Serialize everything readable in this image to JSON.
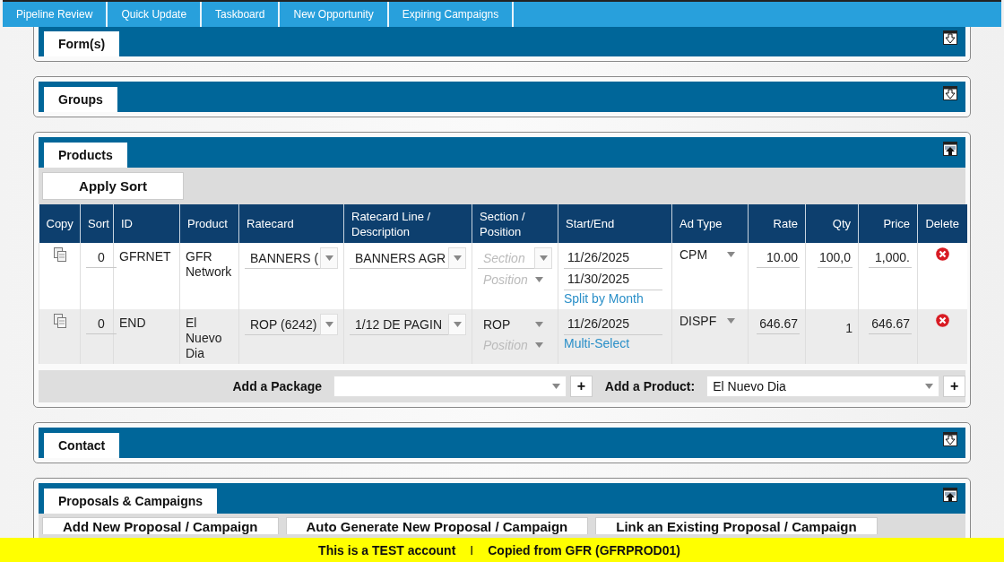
{
  "nav_tabs": [
    {
      "label": "Pipeline Review"
    },
    {
      "label": "Quick Update"
    },
    {
      "label": "Taskboard"
    },
    {
      "label": "New Opportunity"
    },
    {
      "label": "Expiring Campaigns"
    }
  ],
  "sections": [
    {
      "title": "Form(s)",
      "expanded": false,
      "kind": "plain"
    },
    {
      "title": "Groups",
      "expanded": false,
      "kind": "plain"
    },
    {
      "title": "Products",
      "expanded": true,
      "kind": "products"
    },
    {
      "title": "Contact",
      "expanded": false,
      "kind": "plain"
    },
    {
      "title": "Proposals & Campaigns",
      "expanded": true,
      "kind": "proposals"
    }
  ],
  "products": {
    "apply_sort_button": "Apply Sort",
    "columns": [
      {
        "label": "Copy"
      },
      {
        "label": "Sort"
      },
      {
        "label": "ID"
      },
      {
        "label": "Product"
      },
      {
        "label": "Ratecard"
      },
      {
        "label": "Ratecard Line / Description"
      },
      {
        "label": "Section / Position"
      },
      {
        "label": "Start/End"
      },
      {
        "label": "Ad Type"
      },
      {
        "label": "Rate"
      },
      {
        "label": "Qty"
      },
      {
        "label": "Price"
      },
      {
        "label": "Delete"
      }
    ],
    "rows": [
      {
        "sort": "0",
        "id": "GFRNET",
        "product": "GFR Network",
        "ratecard": "BANNERS (",
        "line": "BANNERS AGR",
        "section": {
          "placeholder": "Section"
        },
        "position": {
          "placeholder": "Position"
        },
        "dates": [
          "11/26/2025",
          "11/30/2025"
        ],
        "link": "Split by Month",
        "ad_type": "CPM",
        "rate": "10.00",
        "qty": {
          "value": "100,0",
          "kind": "input"
        },
        "price": "1,000."
      },
      {
        "sort": "0",
        "id": "END",
        "product": "El Nuevo Dia",
        "ratecard": "ROP (6242)",
        "line": "1/12 DE PAGIN",
        "section": {
          "value": "ROP"
        },
        "position": {
          "placeholder": "Position"
        },
        "dates": [
          "11/26/2025"
        ],
        "link": "Multi-Select",
        "ad_type": "DISPF",
        "rate": "646.67",
        "qty": {
          "value": "1",
          "kind": "text"
        },
        "price": "646.67"
      }
    ],
    "add_package": {
      "label": "Add a Package",
      "button": "+"
    },
    "add_product": {
      "label": "Add a Product:",
      "value": "El Nuevo Dia",
      "button": "+"
    }
  },
  "proposals": {
    "buttons": [
      "Add New Proposal / Campaign",
      "Auto Generate New Proposal / Campaign",
      "Link an Existing Proposal / Campaign"
    ]
  },
  "footer": {
    "text_1": "This is a TEST account",
    "separator": "I",
    "text_2": "Copied from GFR (GFRPROD01)"
  }
}
